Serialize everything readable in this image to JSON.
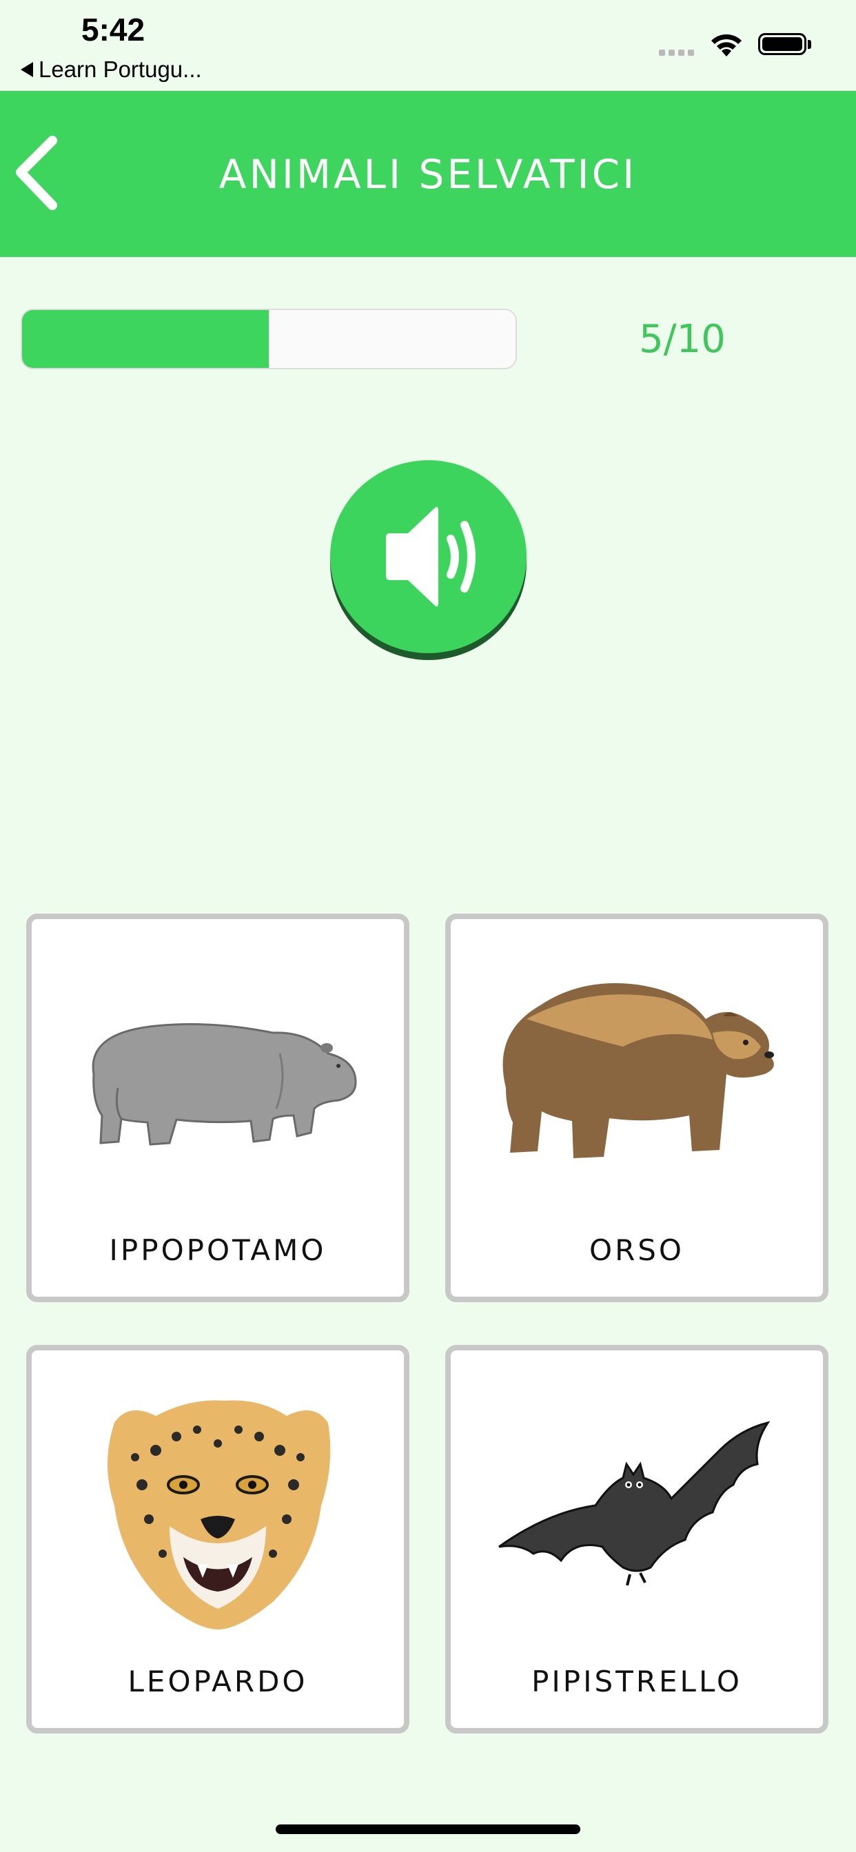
{
  "status_bar": {
    "time": "5:42",
    "back_app": "Learn Portugu..."
  },
  "header": {
    "title": "ANIMALI SELVATICI",
    "back_icon": "chevron-left-icon",
    "color": "#3ed55e"
  },
  "progress": {
    "current": 5,
    "total": 10,
    "fraction": 0.5,
    "label": "5/10"
  },
  "speaker": {
    "icon": "speaker-icon"
  },
  "cards": [
    {
      "label": "IPPOPOTAMO",
      "image": "hippo-image"
    },
    {
      "label": "ORSO",
      "image": "bear-image"
    },
    {
      "label": "LEOPARDO",
      "image": "leopard-image"
    },
    {
      "label": "PIPISTRELLO",
      "image": "bat-image"
    }
  ],
  "colors": {
    "background": "#edfced",
    "accent": "#3ed55e",
    "count_text": "#3fc75c",
    "card_border": "#c8c8c8"
  }
}
